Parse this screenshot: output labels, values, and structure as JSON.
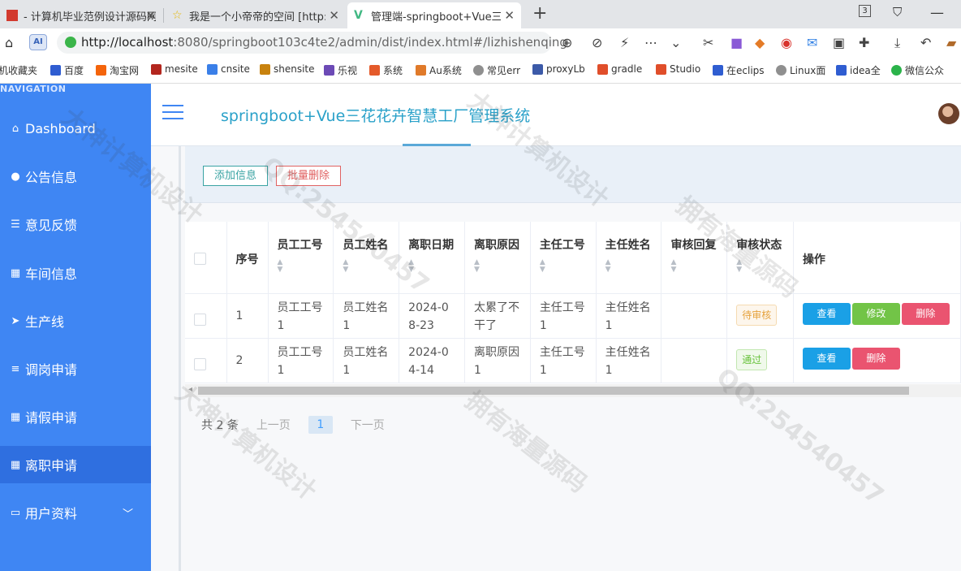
{
  "browser": {
    "tabs": [
      {
        "title": "- 计算机毕业范例设计源码网"
      },
      {
        "title": "我是一个小帝帝的空间 [http:/"
      },
      {
        "title": "管理端-springboot+Vue三花"
      }
    ],
    "tab_count_badge": "3",
    "url_host": "http://localhost",
    "url_rest": ":8080/springboot103c4te2/admin/dist/index.html#/lizhishenqing",
    "ai_label": "AI",
    "bookmarks": [
      "机收藏夹",
      "百度",
      "淘宝网",
      "mesite",
      "cnsite",
      "shensite",
      "乐视",
      "系统",
      "Au系统",
      "常见err",
      "proxyLb",
      "gradle",
      "Studio",
      "在eclips",
      "Linux面",
      "idea全",
      "微信公众"
    ]
  },
  "sidebar": {
    "header": "NAVIGATION",
    "items": [
      {
        "label": "Dashboard",
        "icon": "⌂"
      },
      {
        "label": "公告信息",
        "icon": "●"
      },
      {
        "label": "意见反馈",
        "icon": "☰"
      },
      {
        "label": "车间信息",
        "icon": "▦"
      },
      {
        "label": "生产线",
        "icon": "➤"
      },
      {
        "label": "调岗申请",
        "icon": "≡"
      },
      {
        "label": "请假申请",
        "icon": "▦"
      },
      {
        "label": "离职申请",
        "icon": "▦"
      },
      {
        "label": "用户资料",
        "icon": "▭"
      }
    ]
  },
  "header": {
    "title": "springboot+Vue三花花卉智慧工厂管理系统"
  },
  "toolbar": {
    "add_label": "添加信息",
    "batch_delete_label": "批量删除"
  },
  "table": {
    "columns": [
      "序号",
      "员工工号",
      "员工姓名",
      "离职日期",
      "离职原因",
      "主任工号",
      "主任姓名",
      "审核回复",
      "审核状态",
      "操作"
    ],
    "rows": [
      {
        "index": "1",
        "emp_no": "员工工号1",
        "emp_name": "员工姓名1",
        "date": "2024-08-23",
        "reason": "太累了不干了",
        "dir_no": "主任工号1",
        "dir_name": "主任姓名1",
        "reply": "",
        "status": "待审核"
      },
      {
        "index": "2",
        "emp_no": "员工工号1",
        "emp_name": "员工姓名1",
        "date": "2024-04-14",
        "reason": "离职原因1",
        "dir_no": "主任工号1",
        "dir_name": "主任姓名1",
        "reply": "",
        "status": "通过"
      }
    ],
    "actions": {
      "view": "查看",
      "edit": "修改",
      "delete": "删除"
    }
  },
  "pagination": {
    "total": "共 2 条",
    "prev": "上一页",
    "current": "1",
    "next": "下一页"
  },
  "watermark": {
    "phrases": [
      "大神计算机设计",
      "QQ:254540457",
      "拥有海量源码"
    ]
  },
  "colors": {
    "sidebar": "#3f86f3",
    "accent_title": "#2aa1c9",
    "view_button": "#1aa0e6",
    "edit_button": "#72c447",
    "delete_button": "#ea5470"
  }
}
